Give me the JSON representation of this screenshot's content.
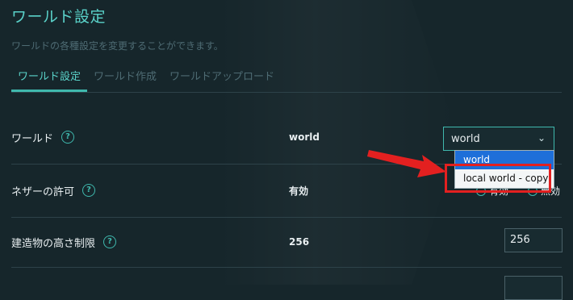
{
  "page": {
    "title": "ワールド設定",
    "subtitle": "ワールドの各種設定を変更することができます。"
  },
  "tabs": [
    {
      "label": "ワールド設定",
      "active": true
    },
    {
      "label": "ワールド作成",
      "active": false
    },
    {
      "label": "ワールドアップロード",
      "active": false
    }
  ],
  "settings": [
    {
      "label": "ワールド",
      "value": "world"
    },
    {
      "label": "ネザーの許可",
      "value": "有効"
    },
    {
      "label": "建造物の高さ制限",
      "value": "256"
    }
  ],
  "world_select": {
    "selected": "world",
    "options": [
      "world",
      "local world - copy"
    ]
  },
  "nether_radio": {
    "options": [
      "有効",
      "無効"
    ]
  },
  "height_input": {
    "value": "256"
  },
  "colors": {
    "accent": "#3fb8ad",
    "annotation": "#e32020",
    "dropdown_highlight": "#1e6fd9"
  }
}
